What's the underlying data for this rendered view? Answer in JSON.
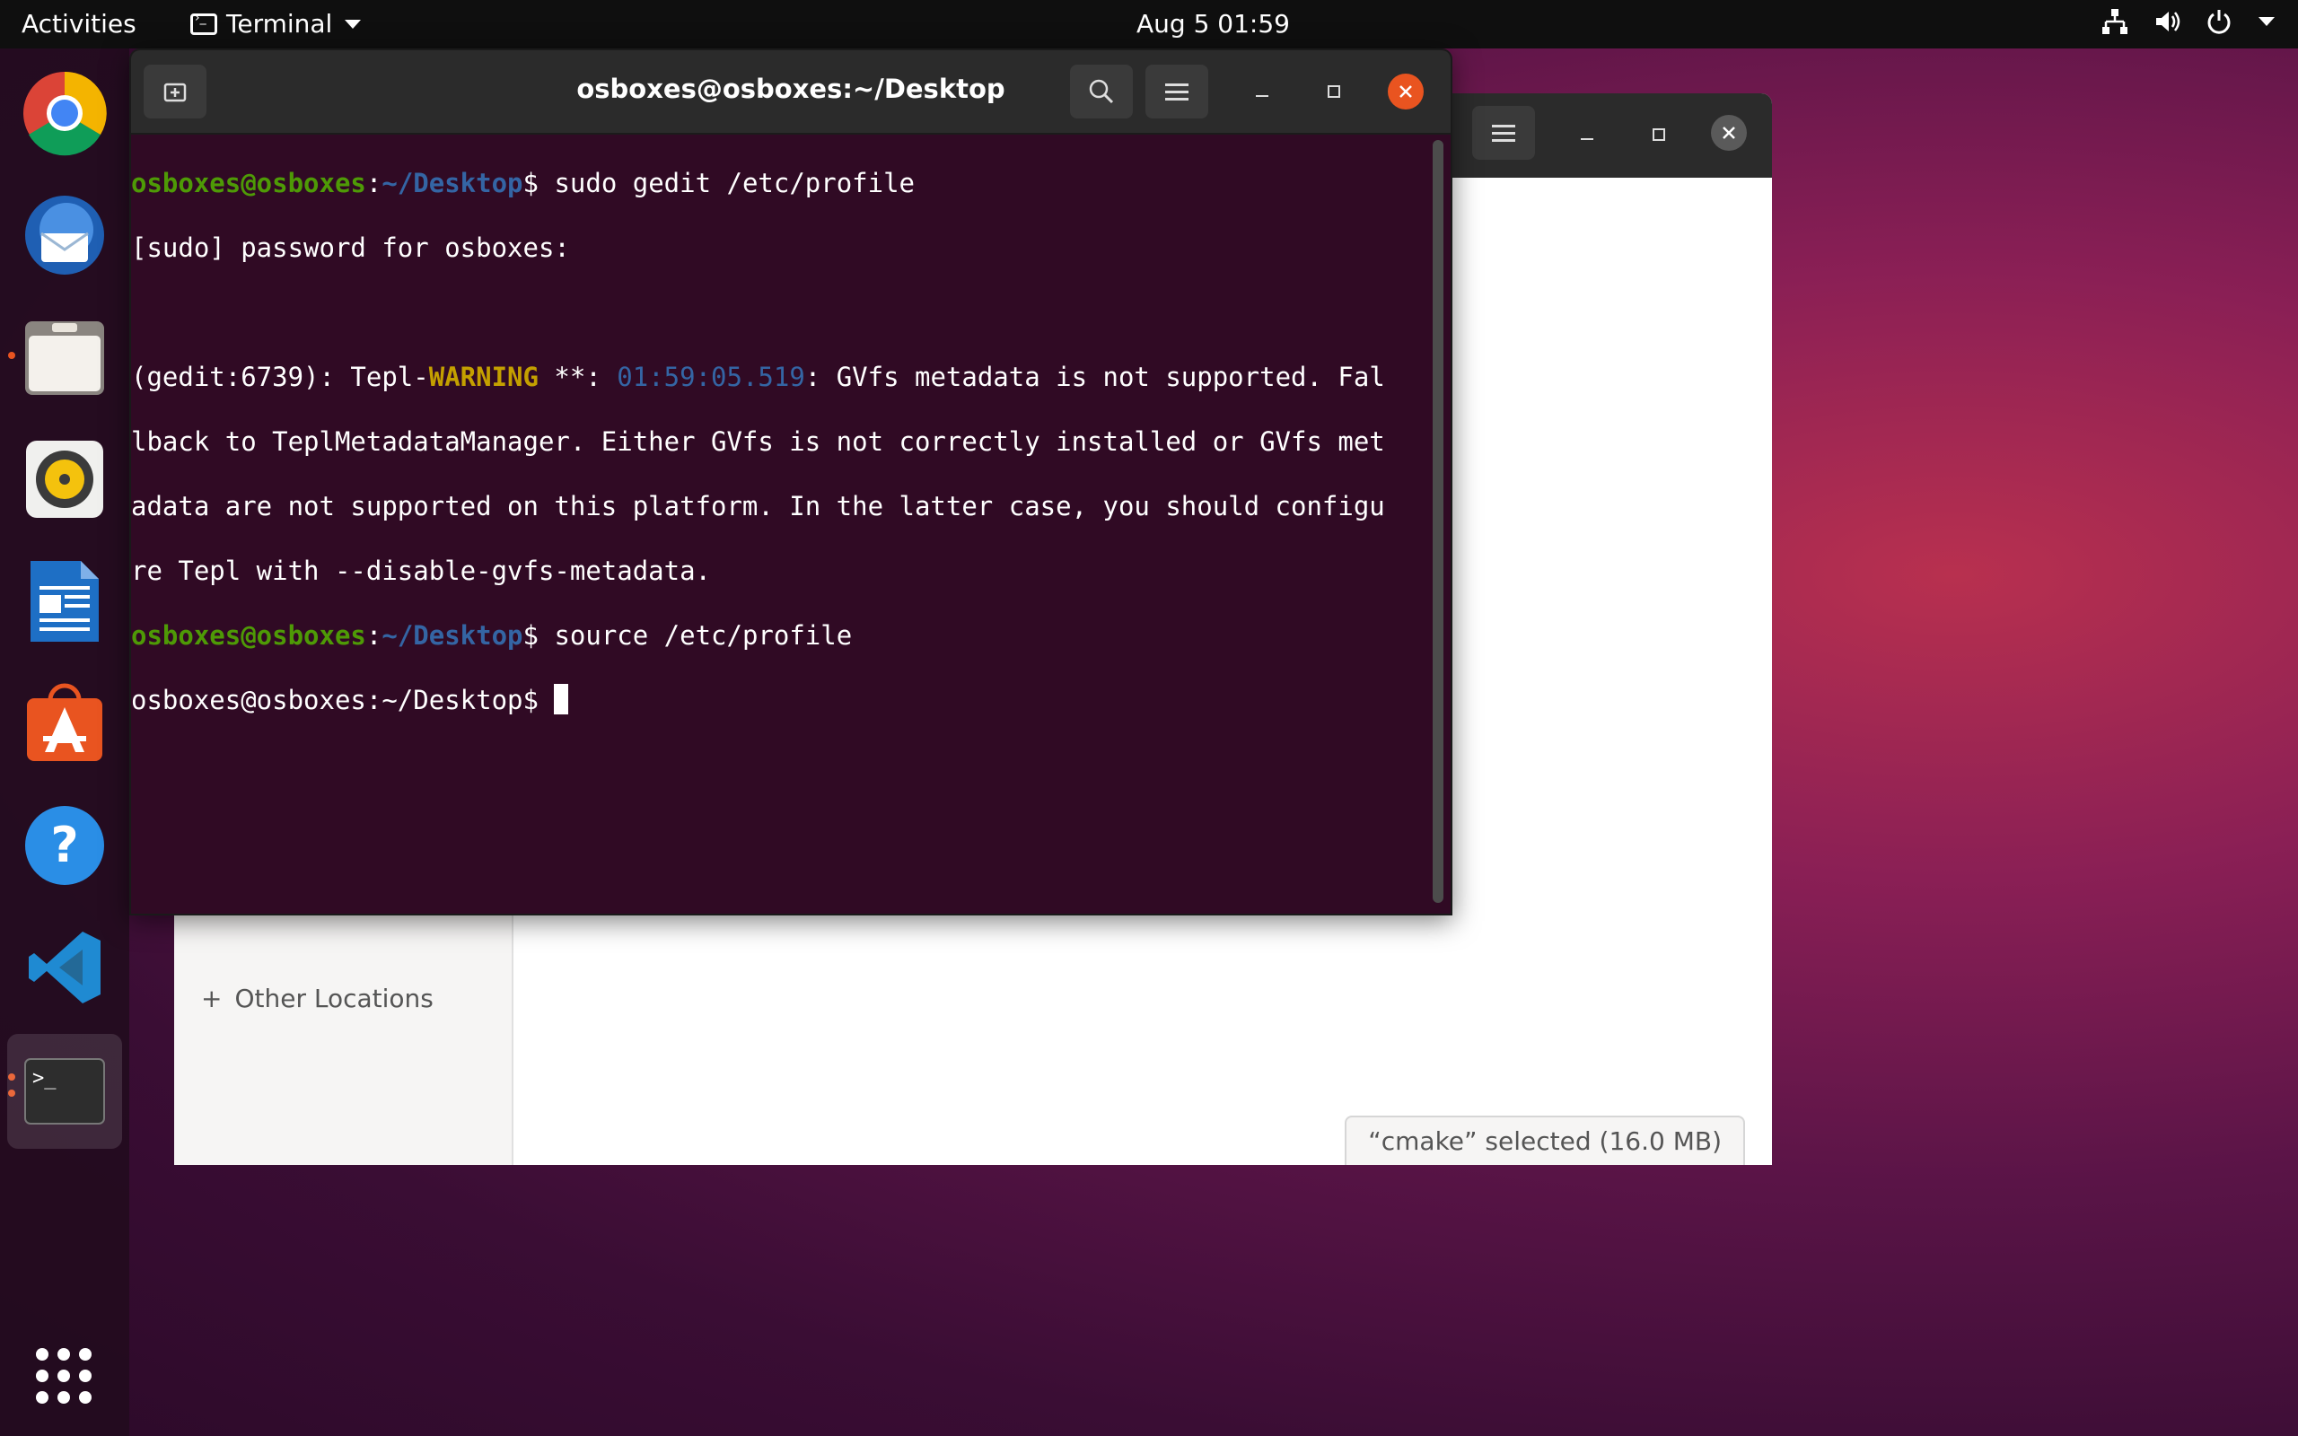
{
  "topbar": {
    "activities": "Activities",
    "app_name": "Terminal",
    "clock": "Aug 5  01:59",
    "tray_icons": [
      "network-icon",
      "volume-icon",
      "power-icon",
      "chevron-down-icon"
    ]
  },
  "dock": {
    "items": [
      {
        "name": "chrome",
        "running": false
      },
      {
        "name": "thunderbird",
        "running": false
      },
      {
        "name": "files",
        "running": true
      },
      {
        "name": "rhythmbox",
        "running": false
      },
      {
        "name": "libreoffice-writer",
        "running": false
      },
      {
        "name": "ubuntu-software",
        "running": false
      },
      {
        "name": "help",
        "running": false
      },
      {
        "name": "vscode",
        "running": false
      },
      {
        "name": "terminal",
        "running": true
      }
    ],
    "show_apps": "apps-grid-icon"
  },
  "file_manager": {
    "other_locations": "Other Locations",
    "status": "“cmake” selected  (16.0 MB)"
  },
  "terminal": {
    "title": "osboxes@osboxes:~/Desktop",
    "user_host": "osboxes@osboxes",
    "path": "~/Desktop",
    "cmd1": "sudo gedit /etc/profile",
    "sudo_prompt": "[sudo] password for osboxes:",
    "warn_prefix": "(gedit:6739): Tepl-",
    "warn_word": "WARNING",
    "warn_mid": " **: ",
    "warn_time": "01:59:05.519",
    "warn_rest1": ": GVfs metadata is not supported. Fal",
    "warn_rest2": "lback to TeplMetadataManager. Either GVfs is not correctly installed or GVfs met",
    "warn_rest3": "adata are not supported on this platform. In the latter case, you should configu",
    "warn_rest4": "re Tepl with --disable-gvfs-metadata.",
    "cmd2": "source /etc/profile",
    "last_prompt": "osboxes@osboxes:~/Desktop$ "
  },
  "colors": {
    "terminal_bg": "#300a24",
    "prompt_green": "#4e9a06",
    "prompt_blue": "#3465a4",
    "warning_yellow": "#c4a000",
    "close_orange": "#e95420"
  }
}
